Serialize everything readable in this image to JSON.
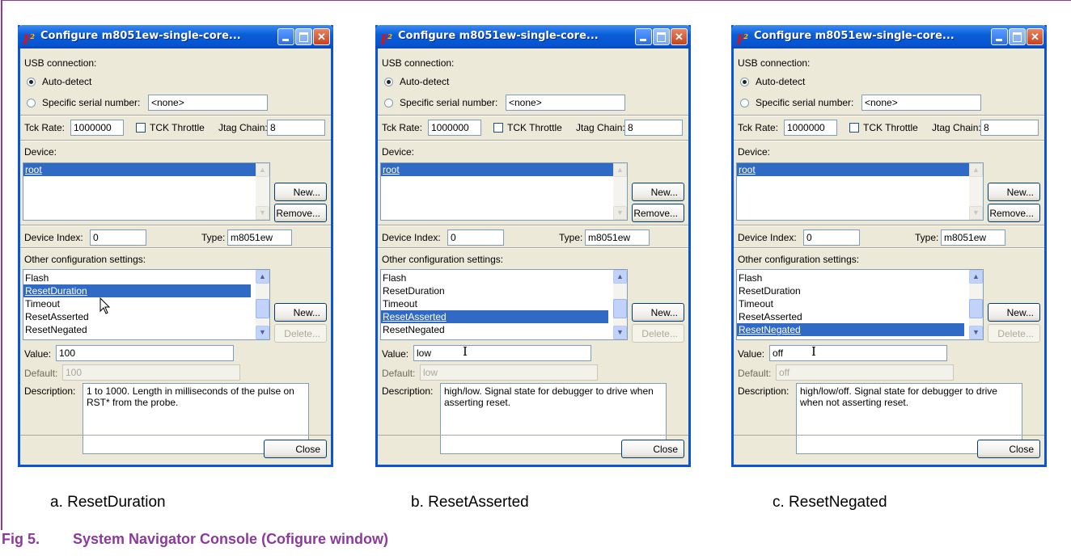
{
  "windows": [
    {
      "title": "Configure m8051ew-single-core...",
      "usb_label": "USB connection:",
      "auto_detect_label": "Auto-detect",
      "specific_serial_label": "Specific serial number:",
      "serial_value": "<none>",
      "tck_rate_label": "Tck Rate:",
      "tck_rate_value": "1000000",
      "tck_throttle_label": "TCK Throttle",
      "jtag_chain_label": "Jtag Chain:",
      "jtag_chain_value": "8",
      "device_label": "Device:",
      "devices": [
        "root"
      ],
      "new_label": "New...",
      "remove_label": "Remove...",
      "device_index_label": "Device Index:",
      "device_index_value": "0",
      "type_label": "Type:",
      "type_value": "m8051ew",
      "other_settings_label": "Other configuration settings:",
      "settings": [
        "Flash",
        "ResetDuration",
        "Timeout",
        "ResetAsserted",
        "ResetNegated"
      ],
      "selected_setting": "ResetDuration",
      "new2_label": "New...",
      "delete_label": "Delete...",
      "value_label": "Value:",
      "value": "100",
      "default_label": "Default:",
      "default_value": "100",
      "description_label": "Description:",
      "description": "1 to 1000.  Length in milliseconds of the pulse on RST* from the probe.",
      "close_label": "Close"
    },
    {
      "title": "Configure m8051ew-single-core...",
      "usb_label": "USB connection:",
      "auto_detect_label": "Auto-detect",
      "specific_serial_label": "Specific serial number:",
      "serial_value": "<none>",
      "tck_rate_label": "Tck Rate:",
      "tck_rate_value": "1000000",
      "tck_throttle_label": "TCK Throttle",
      "jtag_chain_label": "Jtag Chain:",
      "jtag_chain_value": "8",
      "device_label": "Device:",
      "devices": [
        "root"
      ],
      "new_label": "New...",
      "remove_label": "Remove...",
      "device_index_label": "Device Index:",
      "device_index_value": "0",
      "type_label": "Type:",
      "type_value": "m8051ew",
      "other_settings_label": "Other configuration settings:",
      "settings": [
        "Flash",
        "ResetDuration",
        "Timeout",
        "ResetAsserted",
        "ResetNegated"
      ],
      "selected_setting": "ResetAsserted",
      "new2_label": "New...",
      "delete_label": "Delete...",
      "value_label": "Value:",
      "value": "low",
      "default_label": "Default:",
      "default_value": "low",
      "description_label": "Description:",
      "description": "high/low.  Signal state for debugger to drive when asserting reset.",
      "close_label": "Close"
    },
    {
      "title": "Configure m8051ew-single-core...",
      "usb_label": "USB connection:",
      "auto_detect_label": "Auto-detect",
      "specific_serial_label": "Specific serial number:",
      "serial_value": "<none>",
      "tck_rate_label": "Tck Rate:",
      "tck_rate_value": "1000000",
      "tck_throttle_label": "TCK Throttle",
      "jtag_chain_label": "Jtag Chain:",
      "jtag_chain_value": "8",
      "device_label": "Device:",
      "devices": [
        "root"
      ],
      "new_label": "New...",
      "remove_label": "Remove...",
      "device_index_label": "Device Index:",
      "device_index_value": "0",
      "type_label": "Type:",
      "type_value": "m8051ew",
      "other_settings_label": "Other configuration settings:",
      "settings": [
        "Flash",
        "ResetDuration",
        "Timeout",
        "ResetAsserted",
        "ResetNegated"
      ],
      "selected_setting": "ResetNegated",
      "new2_label": "New...",
      "delete_label": "Delete...",
      "value_label": "Value:",
      "value": "off",
      "default_label": "Default:",
      "default_value": "off",
      "description_label": "Description:",
      "description": "high/low/off.  Signal state for debugger to drive when not asserting reset.",
      "close_label": "Close"
    }
  ],
  "captions": [
    "a.   ResetDuration",
    "b.   ResetAsserted",
    "c.   ResetNegated"
  ],
  "figure": {
    "number": "Fig 5.",
    "title": "System Navigator Console (Cofigure window)"
  },
  "icons": {
    "app": "fs2-app-icon",
    "cursor_a": "arrow-cursor-icon",
    "cursor_bc": "text-ibeam-cursor-icon"
  },
  "colors": {
    "titlebar": "#0a5fd8",
    "selection": "#316ac5",
    "figure_caption": "#8b3a9b"
  }
}
